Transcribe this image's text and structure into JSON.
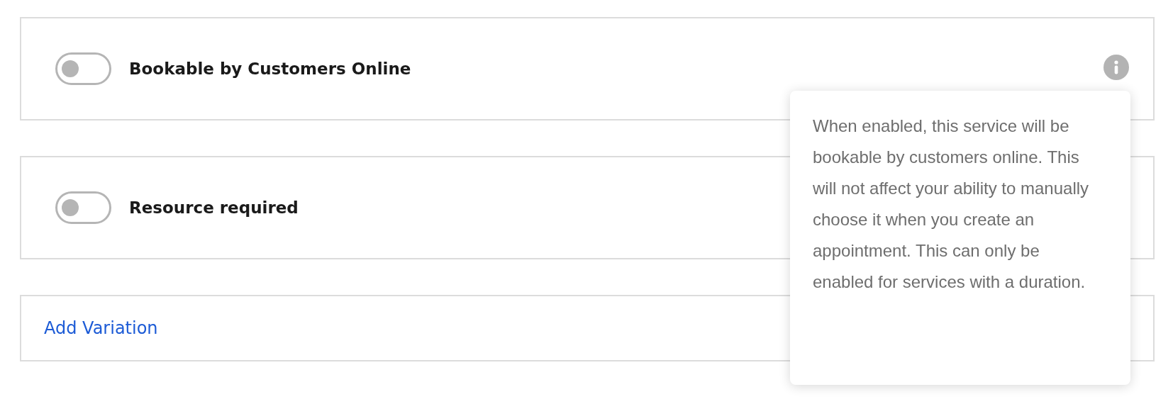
{
  "settings": [
    {
      "kind": "toggle",
      "label": "Bookable by Customers Online",
      "on": false,
      "info": true
    },
    {
      "kind": "toggle",
      "label": "Resource required",
      "on": false,
      "info": false
    },
    {
      "kind": "link",
      "label": "Add Variation"
    }
  ],
  "tooltip": {
    "text": "When enabled, this service will be bookable by customers online. This will not affect your ability to manually choose it when you create an appointment. This can only be enabled for services with a duration."
  }
}
